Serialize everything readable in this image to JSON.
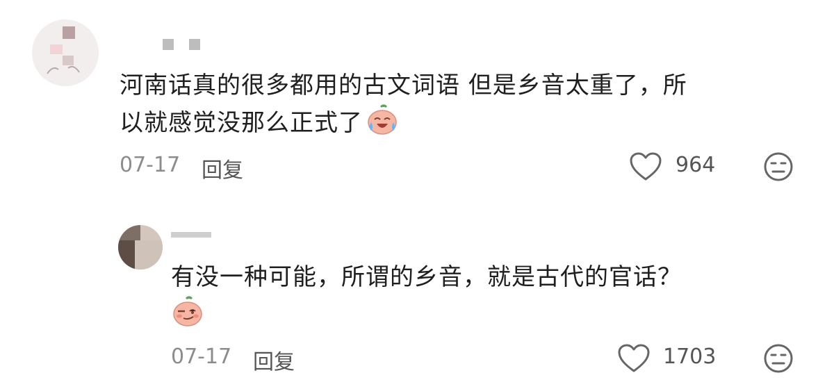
{
  "comments": [
    {
      "username": "",
      "text_line1": "河南话真的很多都用的古文词语 但是乡音太重了，所",
      "text_line2": "以就感觉没那么正式了",
      "emoji": "crying-laugh-emoji",
      "date": "07-17",
      "reply_label": "回复",
      "likes": "964"
    },
    {
      "username": "",
      "text_line1": "有没一种可能，所谓的乡音，就是古代的官话？",
      "emoji": "smirk-emoji",
      "date": "07-17",
      "reply_label": "回复",
      "likes": "1703"
    }
  ],
  "icons": {
    "like": "heart-icon",
    "dislike": "meh-face-icon"
  },
  "colors": {
    "text": "#1f1f1f",
    "meta": "#8c8c8c",
    "icon": "#666666",
    "emoji_skin": "#f6b6a4"
  }
}
